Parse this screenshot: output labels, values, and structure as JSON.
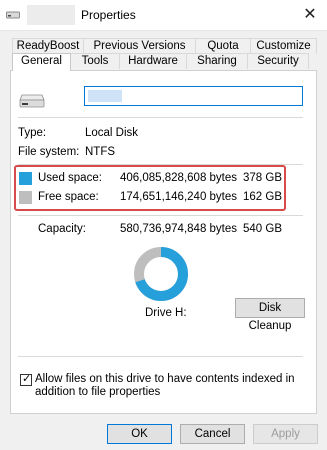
{
  "window": {
    "title": "Properties"
  },
  "tabs_row1": [
    "ReadyBoost",
    "Previous Versions",
    "Quota",
    "Customize"
  ],
  "tabs_row2": [
    "General",
    "Tools",
    "Hardware",
    "Sharing",
    "Security"
  ],
  "active_tab": "General",
  "drive": {
    "name_value": "",
    "type_label": "Type:",
    "type_value": "Local Disk",
    "fs_label": "File system:",
    "fs_value": "NTFS"
  },
  "used": {
    "label": "Used space:",
    "bytes": "406,085,828,608 bytes",
    "size": "378 GB",
    "color": "#26a0da"
  },
  "free": {
    "label": "Free space:",
    "bytes": "174,651,146,240 bytes",
    "size": "162 GB",
    "color": "#bebebe"
  },
  "capacity": {
    "label": "Capacity:",
    "bytes": "580,736,974,848 bytes",
    "size": "540 GB"
  },
  "used_fraction": 0.6993,
  "drive_label": "Drive H:",
  "disk_cleanup_label": "Disk Cleanup",
  "index_checkbox": {
    "label": "Allow files on this drive to have contents indexed in addition to file properties",
    "checked": true
  },
  "buttons": {
    "ok": "OK",
    "cancel": "Cancel",
    "apply": "Apply"
  },
  "icons": {
    "app": "drive-icon",
    "close": "close-icon",
    "check": "checkmark-icon"
  }
}
